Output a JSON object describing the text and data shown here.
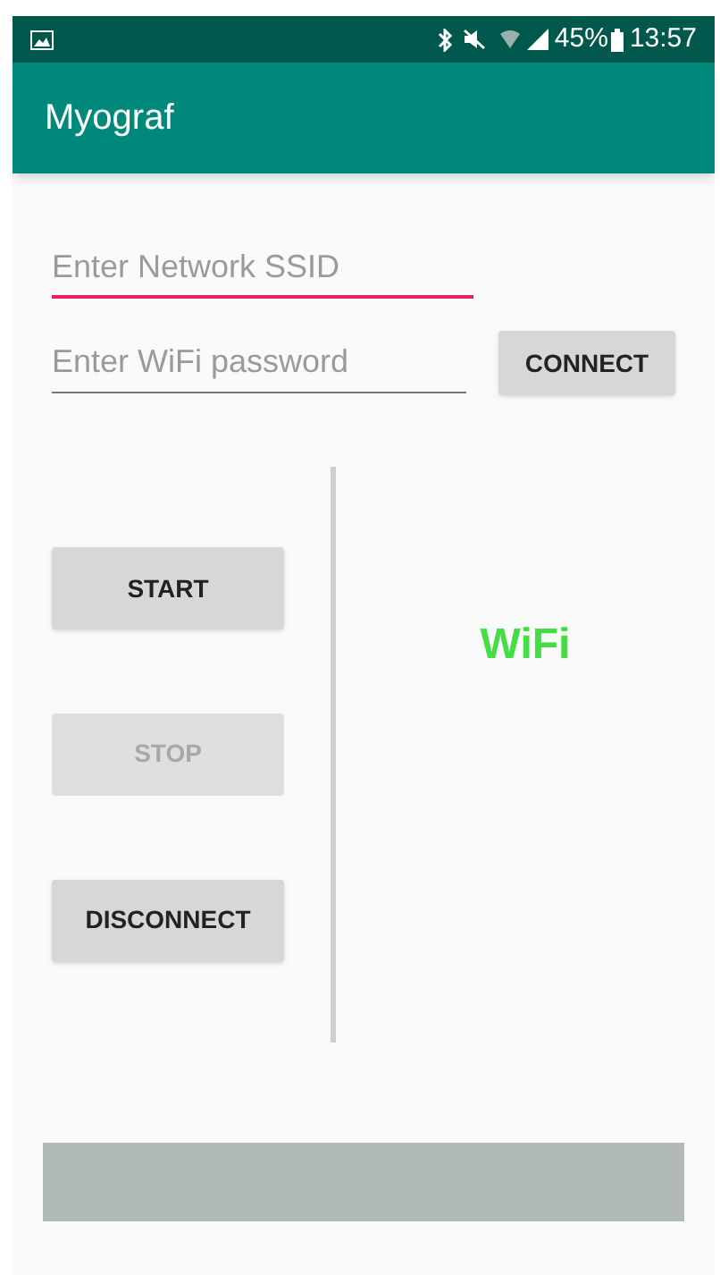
{
  "status_bar": {
    "battery": "45%",
    "time": "13:57"
  },
  "app_bar": {
    "title": "Myograf"
  },
  "fields": [
    {
      "placeholder": "Enter Network SSID",
      "focused": true
    },
    {
      "placeholder": "Enter WiFi password",
      "focused": false
    }
  ],
  "connect_button": {
    "label": "CONNECT"
  },
  "buttons": [
    {
      "label": "START",
      "disabled": false
    },
    {
      "label": "STOP",
      "disabled": true
    },
    {
      "label": "DISCONNECT",
      "disabled": false
    }
  ],
  "connection_type": "WiFi"
}
